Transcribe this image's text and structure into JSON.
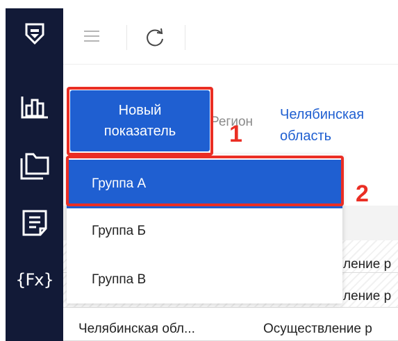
{
  "toolbar": {
    "menu_icon": "hamburger-icon",
    "refresh_icon": "refresh-icon"
  },
  "sidebar": {
    "icons": [
      "shield-logo-icon",
      "chart-icon",
      "folders-icon",
      "document-icon",
      "formula-icon"
    ],
    "formula_text": "{Fx}"
  },
  "new_indicator_button": {
    "label": "Новый показатель"
  },
  "filter": {
    "label": "Регион",
    "value": "Челябинская область"
  },
  "dropdown": {
    "items": [
      "Группа А",
      "Группа Б",
      "Группа В"
    ],
    "selected": "Группа А"
  },
  "annotations": {
    "step1": "1",
    "step2": "2",
    "highlight_color": "#ea2e24"
  },
  "table": {
    "rows": [
      {
        "region": "",
        "activity": "ление р"
      },
      {
        "region": "",
        "activity": "ление р"
      },
      {
        "region": "Челябинская обл...",
        "activity": "Осуществление р"
      }
    ]
  },
  "colors": {
    "sidebar_bg": "#121a37",
    "accent": "#1f5fd1"
  }
}
